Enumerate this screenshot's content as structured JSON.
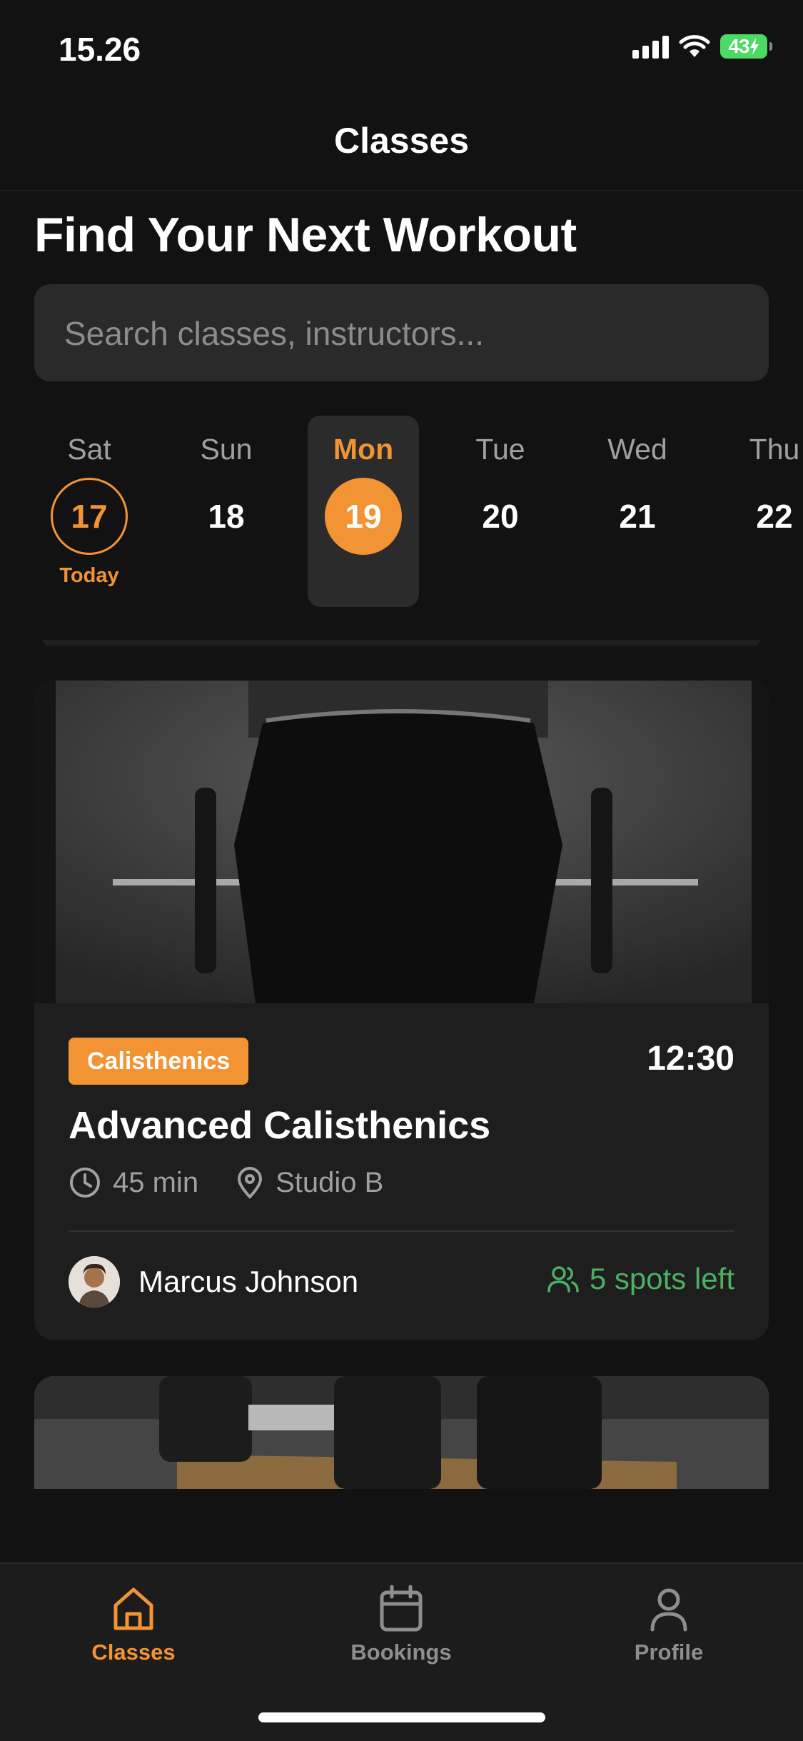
{
  "status_bar": {
    "time": "15.26",
    "battery": "43"
  },
  "nav": {
    "title": "Classes"
  },
  "page": {
    "heading": "Find Your Next Workout"
  },
  "search": {
    "placeholder": "Search classes, instructors..."
  },
  "days": [
    {
      "name": "Sat",
      "date": "17",
      "label": "Today",
      "state": "today"
    },
    {
      "name": "Sun",
      "date": "18",
      "state": "normal"
    },
    {
      "name": "Mon",
      "date": "19",
      "state": "selected"
    },
    {
      "name": "Tue",
      "date": "20",
      "state": "normal"
    },
    {
      "name": "Wed",
      "date": "21",
      "state": "normal"
    },
    {
      "name": "Thu",
      "date": "22",
      "state": "normal"
    }
  ],
  "classes": [
    {
      "category": "Calisthenics",
      "time": "12:30",
      "title": "Advanced Calisthenics",
      "duration": "45 min",
      "location": "Studio B",
      "instructor": "Marcus Johnson",
      "spots": "5 spots left",
      "image_icon": "barbell-athlete-photo"
    },
    {
      "image_icon": "dumbbells-photo"
    }
  ],
  "tabs": [
    {
      "label": "Classes",
      "icon": "home-icon",
      "active": true
    },
    {
      "label": "Bookings",
      "icon": "calendar-icon",
      "active": false
    },
    {
      "label": "Profile",
      "icon": "person-icon",
      "active": false
    }
  ],
  "colors": {
    "accent": "#f29334",
    "background": "#121212",
    "card": "#1e1e1e",
    "success": "#4caf62"
  }
}
